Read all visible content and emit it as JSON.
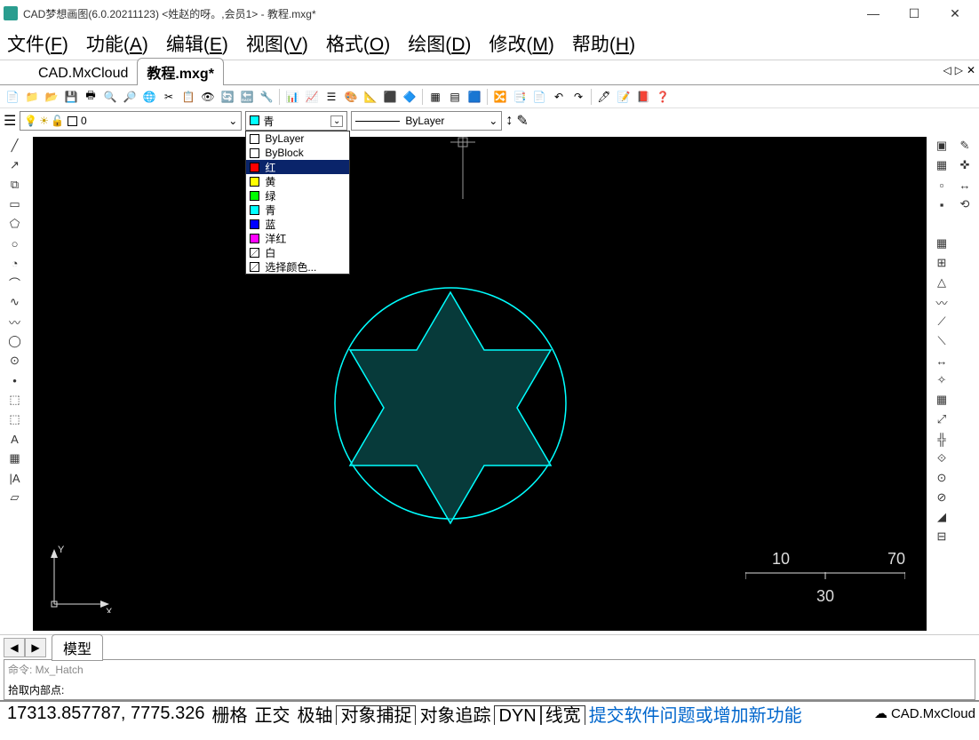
{
  "window": {
    "title": "CAD梦想画图(6.0.20211123) <姓赵的呀。,会员1> - 教程.mxg*"
  },
  "menu": {
    "items": [
      "文件(F)",
      "功能(A)",
      "编辑(E)",
      "视图(V)",
      "格式(O)",
      "绘图(D)",
      "修改(M)",
      "帮助(H)"
    ]
  },
  "doc_tabs": {
    "items": [
      {
        "label": "CAD.MxCloud",
        "active": false
      },
      {
        "label": "教程.mxg*",
        "active": true
      }
    ]
  },
  "layer_combo": {
    "text": "0"
  },
  "color_combo": {
    "selected": "青",
    "options": [
      {
        "swatch": "#ffffff",
        "label": "ByLayer",
        "sel": false
      },
      {
        "swatch": "#ffffff",
        "label": "ByBlock",
        "sel": false
      },
      {
        "swatch": "#ff0000",
        "label": "红",
        "sel": true
      },
      {
        "swatch": "#ffff00",
        "label": "黄",
        "sel": false
      },
      {
        "swatch": "#00ff00",
        "label": "绿",
        "sel": false
      },
      {
        "swatch": "#00ffff",
        "label": "青",
        "sel": false
      },
      {
        "swatch": "#0000ff",
        "label": "蓝",
        "sel": false
      },
      {
        "swatch": "#ff00ff",
        "label": "洋红",
        "sel": false
      },
      {
        "swatch": "#ffffff",
        "label": "白",
        "sel": false,
        "diag": true
      },
      {
        "swatch": "#ffffff",
        "label": "选择颜色...",
        "sel": false,
        "diag": true
      }
    ]
  },
  "linetype_combo": {
    "text": "ByLayer"
  },
  "model_tab": {
    "label": "模型"
  },
  "cmdline": {
    "line1": "命令: Mx_Hatch",
    "line2": "拾取内部点:"
  },
  "statusbar": {
    "coords": "17313.857787, 7775.326",
    "items": [
      {
        "label": "栅格",
        "boxed": false
      },
      {
        "label": "正交",
        "boxed": false
      },
      {
        "label": "极轴",
        "boxed": false
      },
      {
        "label": "对象捕捉",
        "boxed": true
      },
      {
        "label": "对象追踪",
        "boxed": false
      },
      {
        "label": "DYN",
        "boxed": true
      },
      {
        "label": "线宽",
        "boxed": true
      }
    ],
    "link": "提交软件问题或增加新功能",
    "cloud": "CAD.MxCloud"
  },
  "scale": {
    "v1": "10",
    "v2": "70",
    "v3": "30"
  }
}
